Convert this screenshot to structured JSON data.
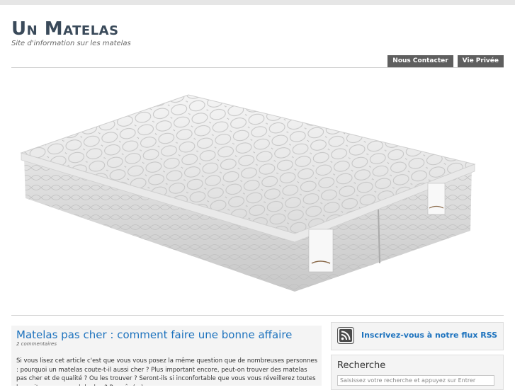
{
  "header": {
    "title": "Un Matelas",
    "tagline": "Site d'information sur les matelas"
  },
  "nav": {
    "items": [
      {
        "label": "Nous Contacter"
      },
      {
        "label": "Vie Privée"
      }
    ]
  },
  "hero": {
    "image": "mattress-image"
  },
  "post": {
    "title": "Matelas pas cher : comment faire une bonne affaire",
    "meta": "2 commentaires",
    "excerpt": "Si vous lisez cet article c'est que vous vous posez la même question que de nombreuses personnes : pourquoi un matelas coute-t-il aussi cher ? Plus important encore, peut-on trouver des matelas pas cher et de qualité ? Ou les trouver ? Seront-ils si inconfortable que vous vous réveillerez toutes les nuits avec un mal de dos ? Pas sûr (...)"
  },
  "sidebar": {
    "rss": {
      "label": "Inscrivez-vous à notre flux RSS",
      "icon": "rss-icon"
    },
    "search": {
      "title": "Recherche",
      "placeholder": "Saisissez votre recherche et appuyez sur Entrer"
    }
  },
  "colors": {
    "title": "#3a4a5a",
    "link": "#1e73be",
    "nav_bg": "#5f5f5f"
  }
}
